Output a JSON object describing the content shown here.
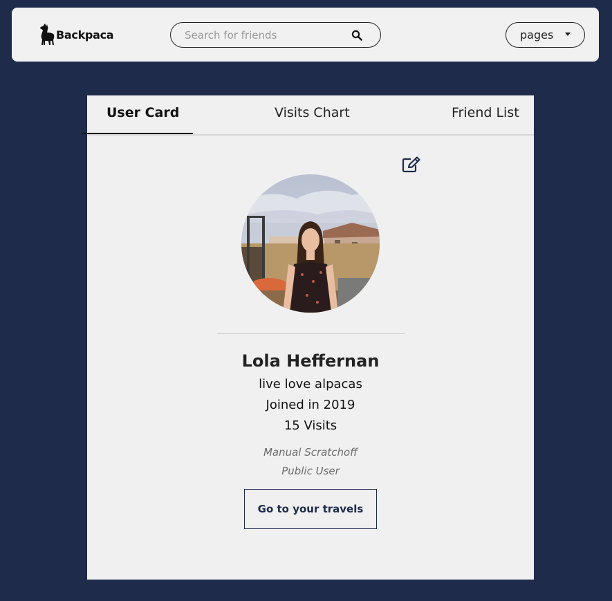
{
  "header": {
    "brand": "Backpaca",
    "search": {
      "placeholder": "Search for friends",
      "value": ""
    },
    "pages_label": "pages"
  },
  "tabs": [
    {
      "label": "User Card",
      "active": true
    },
    {
      "label": "Visits Chart",
      "active": false
    },
    {
      "label": "Friend List",
      "active": false
    }
  ],
  "profile": {
    "name": "Lola Heffernan",
    "tagline": "live love alpacas",
    "joined": "Joined in 2019",
    "visits": "15 Visits",
    "meta_line1": "Manual Scratchoff",
    "meta_line2": "Public User",
    "button_label": "Go to your travels"
  },
  "icons": {
    "logo": "alpaca-icon",
    "search": "search-icon",
    "dropdown": "chevron-down-icon",
    "edit": "edit-icon"
  },
  "colors": {
    "background": "#1f2b4a",
    "surface": "#f0f0f0",
    "accent": "#1f2b4a"
  }
}
